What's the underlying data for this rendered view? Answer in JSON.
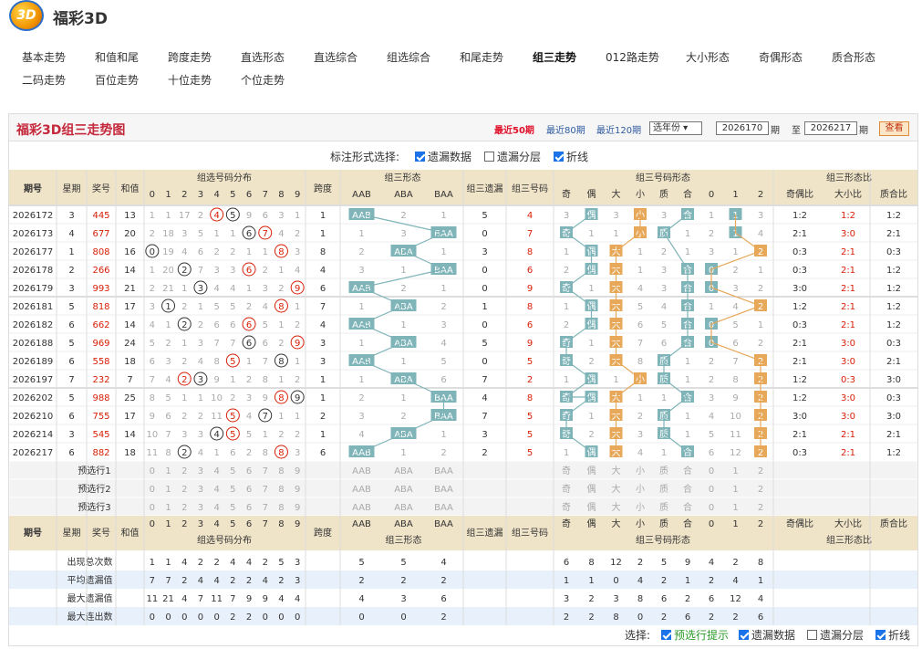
{
  "site": {
    "logo_text": "3D",
    "title": "福彩3D"
  },
  "nav": {
    "row1": [
      "基本走势",
      "和值和尾",
      "跨度走势",
      "直选形态",
      "直选综合",
      "组选综合",
      "和尾走势",
      "组三走势",
      "012路走势",
      "大小形态",
      "奇偶形态",
      "质合形态"
    ],
    "row2": [
      "二码走势",
      "百位走势",
      "十位走势",
      "个位走势"
    ],
    "active": "组三走势"
  },
  "panel": {
    "title": "福彩3D组三走势图",
    "ranges": [
      "最近50期",
      "最近80期",
      "最近120期"
    ],
    "year_select": "选年份 ▾",
    "from_period": "2026170",
    "to_period": "2026217",
    "period_label": "期",
    "to_label": "至",
    "view_button": "查看"
  },
  "options": {
    "label": "标注形式选择:",
    "items": [
      {
        "label": "遗漏数据",
        "checked": true
      },
      {
        "label": "遗漏分层",
        "checked": false
      },
      {
        "label": "折线",
        "checked": true
      }
    ]
  },
  "headers": {
    "period": "期号",
    "weekday": "星期",
    "prize": "奖号",
    "sum": "和值",
    "dist_group": "组选号码分布",
    "digits": [
      "0",
      "1",
      "2",
      "3",
      "4",
      "5",
      "6",
      "7",
      "8",
      "9"
    ],
    "span": "跨度",
    "form_group": "组三形态",
    "forms": [
      "AAB",
      "ABA",
      "BAA"
    ],
    "miss": "组三遗漏",
    "num": "组三号码",
    "shape_group": "组三号码形态",
    "shapes": [
      "奇",
      "偶",
      "大",
      "小",
      "质",
      "合",
      "0",
      "1",
      "2"
    ],
    "ratio_group": "组三形态比",
    "ratios": [
      "奇偶比",
      "大小比",
      "质合比"
    ]
  },
  "rows": [
    {
      "p": "2026172",
      "w": "3",
      "n": "445",
      "s": "13",
      "d": [
        "1",
        "1",
        "17",
        "2",
        "4",
        "5",
        "9",
        "6",
        "3",
        "1"
      ],
      "k": "1",
      "f": [
        "AAB",
        "2",
        "1"
      ],
      "m": "5",
      "g": "4",
      "h": [
        "3",
        "偶",
        "3",
        "小",
        "3",
        "合",
        "1",
        "1",
        "3"
      ],
      "r": [
        "1:2",
        "1:2",
        "1:2"
      ]
    },
    {
      "p": "2026173",
      "w": "4",
      "n": "677",
      "s": "20",
      "d": [
        "2",
        "18",
        "3",
        "5",
        "1",
        "1",
        "6",
        "7",
        "4",
        "2"
      ],
      "k": "1",
      "f": [
        "1",
        "3",
        "BAA"
      ],
      "m": "0",
      "g": "7",
      "h": [
        "奇",
        "1",
        "1",
        "小",
        "质",
        "1",
        "2",
        "1",
        "4"
      ],
      "r": [
        "2:1",
        "3:0",
        "2:1"
      ]
    },
    {
      "p": "2026177",
      "w": "1",
      "n": "808",
      "s": "16",
      "d": [
        "0",
        "19",
        "4",
        "6",
        "2",
        "2",
        "1",
        "1",
        "8",
        "3"
      ],
      "k": "8",
      "f": [
        "2",
        "ABA",
        "1"
      ],
      "m": "3",
      "g": "8",
      "h": [
        "1",
        "偶",
        "大",
        "1",
        "2",
        "1",
        "3",
        "1",
        "2"
      ],
      "r": [
        "0:3",
        "2:1",
        "0:3"
      ]
    },
    {
      "p": "2026178",
      "w": "2",
      "n": "266",
      "s": "14",
      "d": [
        "1",
        "20",
        "2",
        "7",
        "3",
        "3",
        "6",
        "2",
        "1",
        "4"
      ],
      "k": "4",
      "f": [
        "3",
        "1",
        "BAA"
      ],
      "m": "0",
      "g": "6",
      "h": [
        "2",
        "偶",
        "大",
        "1",
        "3",
        "合",
        "0",
        "2",
        "1"
      ],
      "r": [
        "0:3",
        "2:1",
        "1:2"
      ]
    },
    {
      "p": "2026179",
      "w": "3",
      "n": "993",
      "s": "21",
      "d": [
        "2",
        "21",
        "1",
        "3",
        "4",
        "4",
        "1",
        "3",
        "2",
        "9"
      ],
      "k": "6",
      "f": [
        "AAB",
        "2",
        "1"
      ],
      "m": "0",
      "g": "9",
      "h": [
        "奇",
        "1",
        "大",
        "4",
        "3",
        "合",
        "0",
        "3",
        "2"
      ],
      "r": [
        "3:0",
        "2:1",
        "1:2"
      ]
    },
    {
      "p": "2026181",
      "w": "5",
      "n": "818",
      "s": "17",
      "d": [
        "3",
        "1",
        "2",
        "1",
        "5",
        "5",
        "2",
        "4",
        "8",
        "1"
      ],
      "k": "7",
      "f": [
        "1",
        "ABA",
        "2"
      ],
      "m": "1",
      "g": "8",
      "h": [
        "1",
        "偶",
        "大",
        "5",
        "4",
        "合",
        "1",
        "4",
        "2"
      ],
      "r": [
        "1:2",
        "2:1",
        "1:2"
      ]
    },
    {
      "p": "2026182",
      "w": "6",
      "n": "662",
      "s": "14",
      "d": [
        "4",
        "1",
        "2",
        "2",
        "6",
        "6",
        "6",
        "5",
        "1",
        "2"
      ],
      "k": "4",
      "f": [
        "AAB",
        "1",
        "3"
      ],
      "m": "0",
      "g": "6",
      "h": [
        "2",
        "偶",
        "大",
        "6",
        "5",
        "合",
        "0",
        "5",
        "1"
      ],
      "r": [
        "0:3",
        "2:1",
        "1:2"
      ]
    },
    {
      "p": "2026188",
      "w": "5",
      "n": "969",
      "s": "24",
      "d": [
        "5",
        "2",
        "1",
        "3",
        "7",
        "7",
        "6",
        "6",
        "2",
        "9"
      ],
      "k": "3",
      "f": [
        "1",
        "ABA",
        "4"
      ],
      "m": "5",
      "g": "9",
      "h": [
        "奇",
        "1",
        "大",
        "7",
        "6",
        "合",
        "0",
        "6",
        "2"
      ],
      "r": [
        "2:1",
        "3:0",
        "0:3"
      ]
    },
    {
      "p": "2026189",
      "w": "6",
      "n": "558",
      "s": "18",
      "d": [
        "6",
        "3",
        "2",
        "4",
        "8",
        "5",
        "1",
        "7",
        "8",
        "1"
      ],
      "k": "3",
      "f": [
        "AAB",
        "1",
        "5"
      ],
      "m": "0",
      "g": "5",
      "h": [
        "奇",
        "2",
        "大",
        "8",
        "质",
        "1",
        "2",
        "7",
        "2"
      ],
      "r": [
        "2:1",
        "3:0",
        "2:1"
      ]
    },
    {
      "p": "2026197",
      "w": "7",
      "n": "232",
      "s": "7",
      "d": [
        "7",
        "4",
        "2",
        "3",
        "9",
        "1",
        "2",
        "8",
        "1",
        "2"
      ],
      "k": "1",
      "f": [
        "1",
        "ABA",
        "6"
      ],
      "m": "7",
      "g": "2",
      "h": [
        "1",
        "偶",
        "1",
        "小",
        "质",
        "1",
        "2",
        "8",
        "2"
      ],
      "r": [
        "1:2",
        "0:3",
        "3:0"
      ]
    },
    {
      "p": "2026202",
      "w": "5",
      "n": "988",
      "s": "25",
      "d": [
        "8",
        "5",
        "1",
        "1",
        "10",
        "2",
        "3",
        "9",
        "8",
        "9"
      ],
      "k": "1",
      "f": [
        "2",
        "1",
        "BAA"
      ],
      "m": "4",
      "g": "8",
      "h": [
        "奇",
        "偶",
        "大",
        "1",
        "1",
        "合",
        "3",
        "9",
        "2"
      ],
      "r": [
        "1:2",
        "3:0",
        "0:3"
      ]
    },
    {
      "p": "2026210",
      "w": "6",
      "n": "755",
      "s": "17",
      "d": [
        "9",
        "6",
        "2",
        "2",
        "11",
        "5",
        "4",
        "7",
        "1",
        "1"
      ],
      "k": "2",
      "f": [
        "3",
        "2",
        "BAA"
      ],
      "m": "7",
      "g": "5",
      "h": [
        "奇",
        "1",
        "大",
        "2",
        "质",
        "1",
        "4",
        "10",
        "2"
      ],
      "r": [
        "3:0",
        "3:0",
        "3:0"
      ]
    },
    {
      "p": "2026214",
      "w": "3",
      "n": "545",
      "s": "14",
      "d": [
        "10",
        "7",
        "3",
        "3",
        "4",
        "5",
        "5",
        "1",
        "2",
        "2"
      ],
      "k": "1",
      "f": [
        "4",
        "ABA",
        "1"
      ],
      "m": "3",
      "g": "5",
      "h": [
        "奇",
        "2",
        "大",
        "3",
        "质",
        "1",
        "5",
        "11",
        "2"
      ],
      "r": [
        "2:1",
        "2:1",
        "2:1"
      ]
    },
    {
      "p": "2026217",
      "w": "6",
      "n": "882",
      "s": "18",
      "d": [
        "11",
        "8",
        "2",
        "4",
        "1",
        "6",
        "2",
        "8",
        "8",
        "3"
      ],
      "k": "6",
      "f": [
        "AAB",
        "1",
        "2"
      ],
      "m": "2",
      "g": "5",
      "h": [
        "1",
        "偶",
        "大",
        "4",
        "1",
        "合",
        "6",
        "12",
        "2"
      ],
      "r": [
        "0:3",
        "2:1",
        "1:2"
      ]
    }
  ],
  "preselect": [
    "预选行1",
    "预选行2",
    "预选行3"
  ],
  "stats": {
    "labels": [
      "出现总次数",
      "平均遗漏值",
      "最大遗漏值",
      "最大连出数"
    ],
    "d": [
      [
        "1",
        "1",
        "4",
        "2",
        "2",
        "4",
        "4",
        "2",
        "5",
        "3"
      ],
      [
        "7",
        "7",
        "2",
        "4",
        "4",
        "2",
        "2",
        "4",
        "2",
        "3"
      ],
      [
        "11",
        "21",
        "4",
        "7",
        "11",
        "7",
        "9",
        "9",
        "4",
        "4"
      ],
      [
        "0",
        "0",
        "0",
        "0",
        "0",
        "2",
        "2",
        "0",
        "0",
        "0"
      ]
    ],
    "f": [
      [
        "5",
        "5",
        "4"
      ],
      [
        "2",
        "2",
        "2"
      ],
      [
        "4",
        "3",
        "6"
      ],
      [
        "0",
        "0",
        "2"
      ]
    ],
    "h": [
      [
        "6",
        "8",
        "12",
        "2",
        "5",
        "9",
        "4",
        "2",
        "8"
      ],
      [
        "1",
        "1",
        "0",
        "4",
        "2",
        "1",
        "2",
        "4",
        "1"
      ],
      [
        "3",
        "2",
        "3",
        "8",
        "6",
        "2",
        "6",
        "12",
        "4"
      ],
      [
        "2",
        "2",
        "8",
        "0",
        "2",
        "6",
        "2",
        "2",
        "6"
      ]
    ]
  },
  "bottom": {
    "label": "选择:",
    "items": [
      {
        "label": "预选行提示",
        "checked": true
      },
      {
        "label": "遗漏数据",
        "checked": true
      },
      {
        "label": "遗漏分层",
        "checked": false
      },
      {
        "label": "折线",
        "checked": true
      }
    ]
  },
  "colors": {
    "red": "#d81e06",
    "hit": "#7fb4b8",
    "orange": "#e8a85a",
    "header": "#efe3c8",
    "title": "#c4283a",
    "miss": "#aaaaaa"
  }
}
